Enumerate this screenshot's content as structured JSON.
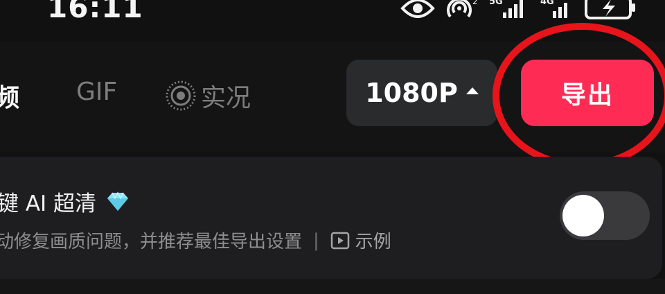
{
  "status_bar": {
    "time": "16:11",
    "network_5g": "5G",
    "network_4g": "4G",
    "hotspot_badge": "2"
  },
  "tabs": [
    {
      "label": "视频",
      "visible_text": "频",
      "selected": true
    },
    {
      "label": "GIF",
      "selected": false
    },
    {
      "label": "实况",
      "selected": false
    }
  ],
  "resolution": {
    "label": "1080P",
    "icon": "caret-up-icon"
  },
  "export": {
    "label": "导出",
    "color": "#fe2c55"
  },
  "annotation": {
    "color": "#e8141b",
    "shape": "ellipse around export button"
  },
  "hd_setting": {
    "title": "键 AI 超清",
    "badge_icon": "diamond-icon",
    "description": "动修复画质问题，并推荐最佳导出设置",
    "separator": "|",
    "example_label": "示例",
    "enabled": false
  }
}
